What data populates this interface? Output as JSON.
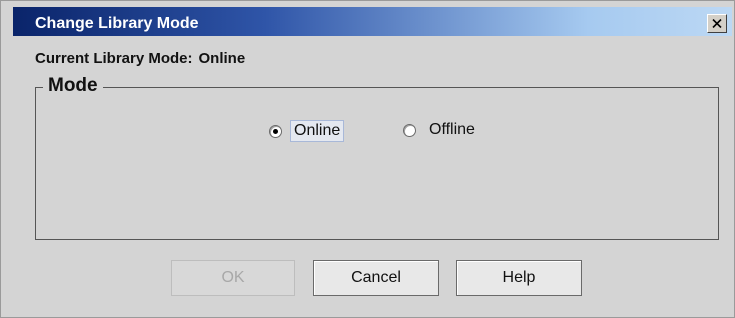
{
  "window": {
    "title": "Change Library Mode",
    "close_glyph": "×"
  },
  "current_mode": {
    "label": "Current Library Mode:",
    "value": "Online"
  },
  "mode_group": {
    "legend": "Mode",
    "options": [
      {
        "label": "Online",
        "selected": true
      },
      {
        "label": "Offline",
        "selected": false
      }
    ]
  },
  "buttons": {
    "ok": {
      "label": "OK",
      "enabled": false
    },
    "cancel": {
      "label": "Cancel",
      "enabled": true
    },
    "help": {
      "label": "Help",
      "enabled": true
    }
  },
  "colors": {
    "titlebar_start": "#0a246a",
    "titlebar_end": "#bcd8f4",
    "dialog_background": "#d4d4d4"
  },
  "icons": {
    "close": "close-icon",
    "radio_selected": "radio-selected-icon",
    "radio_unselected": "radio-unselected-icon"
  }
}
